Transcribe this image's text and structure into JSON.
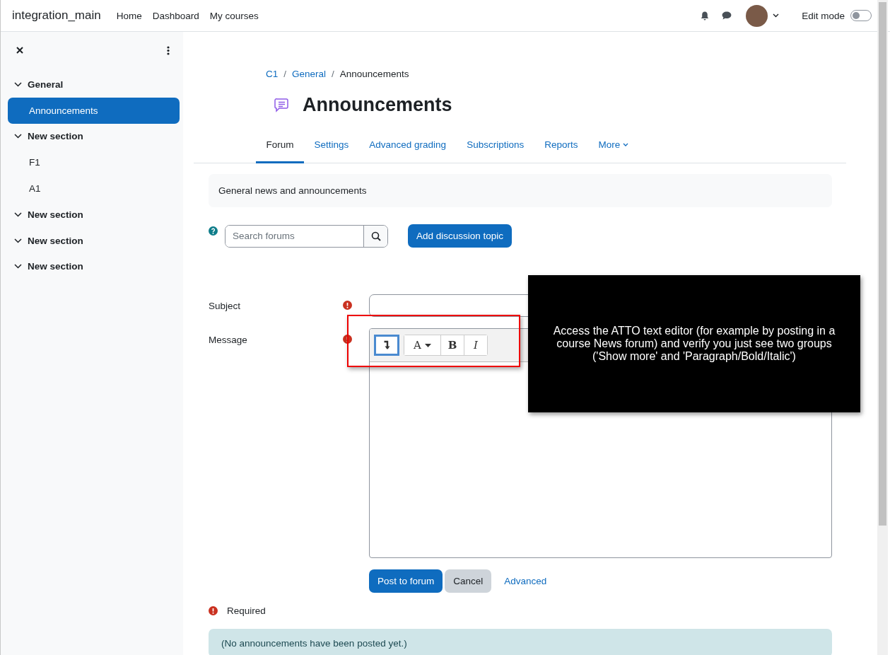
{
  "navbar": {
    "brand": "integration_main",
    "links": [
      "Home",
      "Dashboard",
      "My courses"
    ],
    "edit_mode": {
      "label": "Edit mode",
      "on": false
    }
  },
  "sidebar": {
    "items": [
      {
        "label": "General",
        "expanded": true,
        "children": [
          {
            "label": "Announcements",
            "selected": true
          }
        ]
      },
      {
        "label": "New section",
        "expanded": true,
        "children": [
          {
            "label": "F1",
            "selected": false
          },
          {
            "label": "A1",
            "selected": false
          }
        ]
      },
      {
        "label": "New section",
        "expanded": true
      },
      {
        "label": "New section",
        "expanded": true
      },
      {
        "label": "New section",
        "expanded": true
      }
    ]
  },
  "breadcrumb": {
    "separator": "/",
    "items": [
      {
        "label": "C1",
        "link": true
      },
      {
        "label": "General",
        "link": true
      },
      {
        "label": "Announcements",
        "link": false
      }
    ]
  },
  "page_title": "Announcements",
  "tabs": [
    {
      "label": "Forum",
      "selected": true
    },
    {
      "label": "Settings",
      "selected": false
    },
    {
      "label": "Advanced grading",
      "selected": false
    },
    {
      "label": "Subscriptions",
      "selected": false
    },
    {
      "label": "Reports",
      "selected": false
    },
    {
      "label": "More",
      "selected": false
    }
  ],
  "description": "General news and announcements",
  "search": {
    "placeholder": "Search forums"
  },
  "add_button": "Add discussion topic",
  "form": {
    "fields": [
      {
        "label": "Subject",
        "kind": "text",
        "required": true
      },
      {
        "label": "Message",
        "kind": "editor",
        "required": true
      }
    ],
    "toolbar": [
      {
        "kind": "show-more",
        "focused": true
      },
      {
        "kind": "paragraph",
        "label": "A"
      },
      {
        "kind": "bold",
        "label": "B"
      },
      {
        "kind": "italic",
        "label": "I"
      }
    ],
    "buttons": [
      {
        "label": "Post to forum",
        "kind": "primary"
      },
      {
        "label": "Cancel",
        "kind": "secondary"
      },
      {
        "label": "Advanced",
        "kind": "link"
      }
    ]
  },
  "required_note": "Required",
  "notice": "(No announcements have been posted yet.)",
  "annotation": {
    "text": "Access the ATTO text editor (for example by posting in a course News forum) and verify you just see two groups ('Show more' and 'Paragraph/Bold/Italic')"
  }
}
